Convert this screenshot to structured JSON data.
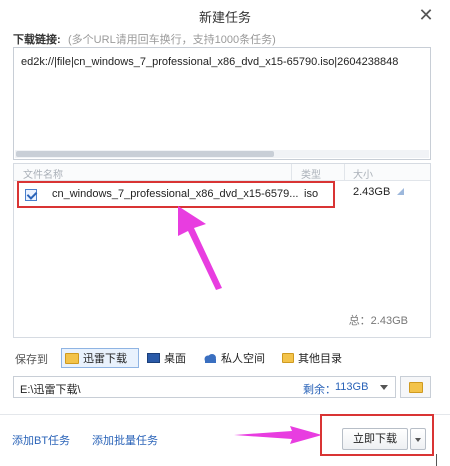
{
  "dialog": {
    "title": "新建任务",
    "close_symbol": "✕"
  },
  "link_section": {
    "label": "下载链接:",
    "hint": "(多个URL请用回车换行，支持1000条任务)",
    "value": "ed2k://|file|cn_windows_7_professional_x86_dvd_x15-65790.iso|2604238848"
  },
  "file_list": {
    "columns": [
      "文件名称",
      "类型",
      "大小"
    ],
    "files": [
      {
        "checked": true,
        "name": "cn_windows_7_professional_x86_dvd_x15-6579...",
        "type": "iso",
        "size": "2.43GB"
      }
    ],
    "total": "总：2.43GB"
  },
  "save_to": {
    "label": "保存到",
    "destinations": [
      {
        "label": "迅雷下载",
        "icon": "folder-icon",
        "selected": true
      },
      {
        "label": "桌面",
        "icon": "monitor-icon",
        "selected": false
      },
      {
        "label": "私人空间",
        "icon": "cloud-icon",
        "selected": false
      },
      {
        "label": "其他目录",
        "icon": "folder-icon",
        "selected": false
      }
    ],
    "path": "E:\\迅雷下载\\",
    "free_label": "剩余：",
    "free_value": "113GB"
  },
  "footer": {
    "add_bt_label": "添加BT任务",
    "add_batch_label": "添加批量任务",
    "download_label": "立即下载"
  },
  "colors": {
    "accent": "#2a63b8",
    "highlight_box": "#d93434",
    "annotation_arrow": "#e83de0"
  }
}
